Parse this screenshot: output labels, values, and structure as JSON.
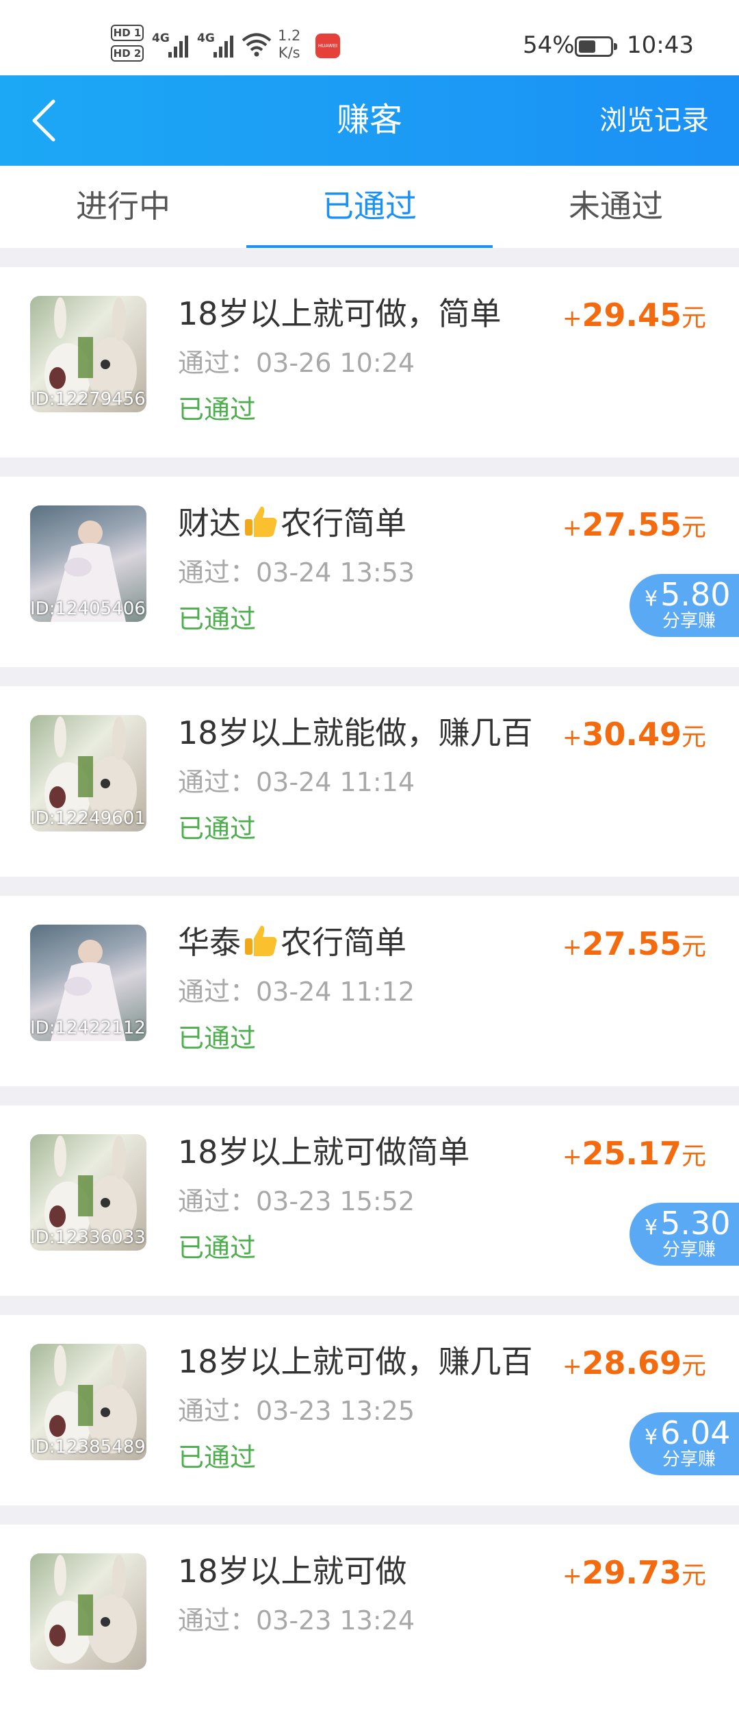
{
  "status_bar": {
    "sim1": "HD 1",
    "sim2": "HD 2",
    "network1": "4G",
    "network2": "4G",
    "speed": "1.2",
    "speed_unit": "K/s",
    "app_icon": "huawei-appgallery-icon",
    "battery_percent": "54%",
    "battery_level": 0.54,
    "time": "10:43"
  },
  "nav": {
    "back_icon": "chevron-left-icon",
    "title": "赚客",
    "right_action": "浏览记录"
  },
  "tabs": [
    {
      "label": "进行中",
      "active": false
    },
    {
      "label": "已通过",
      "active": true
    },
    {
      "label": "未通过",
      "active": false
    }
  ],
  "colors": {
    "accent": "#1b90f5",
    "reward": "#f46a0f",
    "status_passed": "#4cae4c",
    "share_badge": "#5aa9f5"
  },
  "tasks": [
    {
      "id_text": "ID:12279456",
      "title": "18岁以上就可做，简单",
      "time": "通过：03-26 10:24",
      "status": "已通过",
      "reward_prefix": "+",
      "reward": "29.45",
      "reward_unit": "元",
      "thumb": "rabbit"
    },
    {
      "id_text": "ID:12405406",
      "title_a": "财达",
      "title_b": "农行简单",
      "title_icon": "thumbs-up-emoji",
      "time": "通过：03-24 13:53",
      "status": "已通过",
      "reward_prefix": "+",
      "reward": "27.55",
      "reward_unit": "元",
      "share_currency": "¥",
      "share_value": "5.80",
      "share_label": "分享赚",
      "thumb": "bride"
    },
    {
      "id_text": "ID:12249601",
      "title": "18岁以上就能做，赚几百",
      "time": "通过：03-24 11:14",
      "status": "已通过",
      "reward_prefix": "+",
      "reward": "30.49",
      "reward_unit": "元",
      "thumb": "rabbit"
    },
    {
      "id_text": "ID:12422112",
      "title_a": "华泰",
      "title_b": "农行简单",
      "title_icon": "thumbs-up-emoji",
      "time": "通过：03-24 11:12",
      "status": "已通过",
      "reward_prefix": "+",
      "reward": "27.55",
      "reward_unit": "元",
      "thumb": "bride"
    },
    {
      "id_text": "ID:12336033",
      "title": "18岁以上就可做简单",
      "time": "通过：03-23 15:52",
      "status": "已通过",
      "reward_prefix": "+",
      "reward": "25.17",
      "reward_unit": "元",
      "share_currency": "¥",
      "share_value": "5.30",
      "share_label": "分享赚",
      "thumb": "rabbit"
    },
    {
      "id_text": "ID:12385489",
      "title": "18岁以上就可做，赚几百",
      "time": "通过：03-23 13:25",
      "status": "已通过",
      "reward_prefix": "+",
      "reward": "28.69",
      "reward_unit": "元",
      "share_currency": "¥",
      "share_value": "6.04",
      "share_label": "分享赚",
      "thumb": "rabbit"
    },
    {
      "title": "18岁以上就可做",
      "time": "通过：03-23 13:24",
      "reward_prefix": "+",
      "reward": "29.73",
      "reward_unit": "元",
      "thumb": "rabbit"
    }
  ]
}
